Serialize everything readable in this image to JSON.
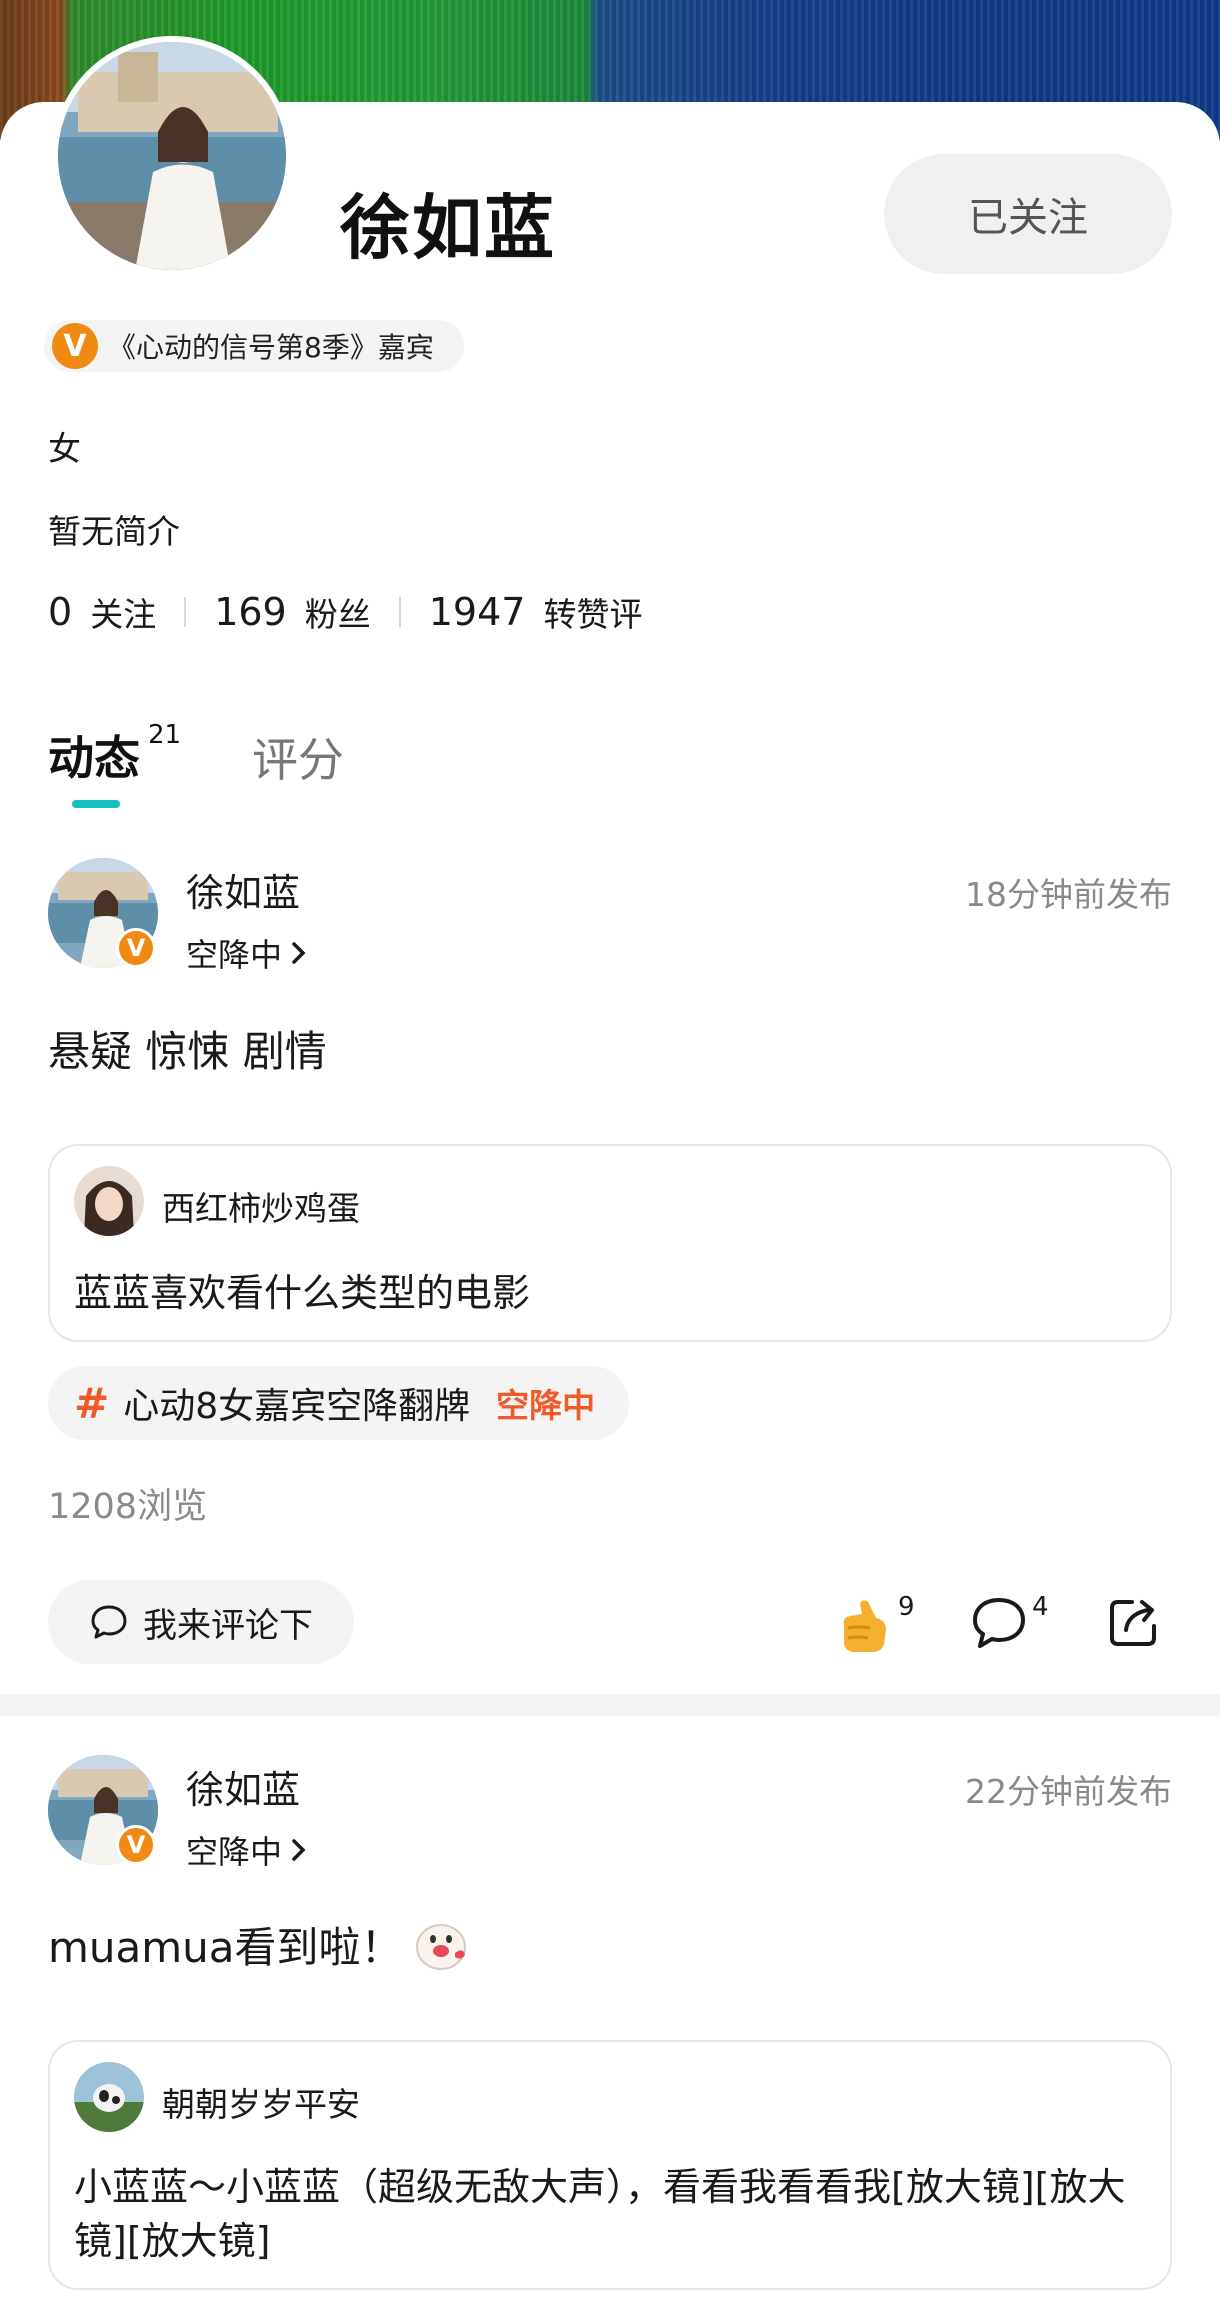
{
  "profile": {
    "name": "徐如蓝",
    "follow_label": "已关注",
    "badge_text": "《心动的信号第8季》嘉宾",
    "gender": "女",
    "bio": "暂无简介",
    "stats": {
      "following_count": "0",
      "following_label": "关注",
      "fans_count": "169",
      "fans_label": "粉丝",
      "interactions_count": "1947",
      "interactions_label": "转赞评"
    }
  },
  "tabs": {
    "active_label": "动态",
    "active_count": "21",
    "inactive_label": "评分"
  },
  "posts": [
    {
      "author": "徐如蓝",
      "status": "空降中",
      "time": "18分钟前发布",
      "text": "悬疑 惊悚 剧情",
      "quote": {
        "name": "西红柿炒鸡蛋",
        "text": "蓝蓝喜欢看什么类型的电影"
      },
      "topic": {
        "text": "心动8女嘉宾空降翻牌",
        "tag": "空降中"
      },
      "views": "1208浏览",
      "comment_placeholder": "我来评论下",
      "likes": "9",
      "comments": "4"
    },
    {
      "author": "徐如蓝",
      "status": "空降中",
      "time": "22分钟前发布",
      "text": "muamua看到啦！",
      "quote": {
        "name": "朝朝岁岁平安",
        "text": "小蓝蓝～小蓝蓝（超级无敌大声），看看我看看我[放大镜][放大镜][放大镜]"
      }
    }
  ],
  "colors": {
    "accent_orange": "#f08a14",
    "topic_red": "#f05a28",
    "tab_indicator": "#18bfbf"
  },
  "icons": [
    "v-badge-icon",
    "hash-icon",
    "chevron-right-icon",
    "comment-bubble-icon",
    "thumbs-up-icon",
    "share-icon",
    "emoji-icon"
  ]
}
